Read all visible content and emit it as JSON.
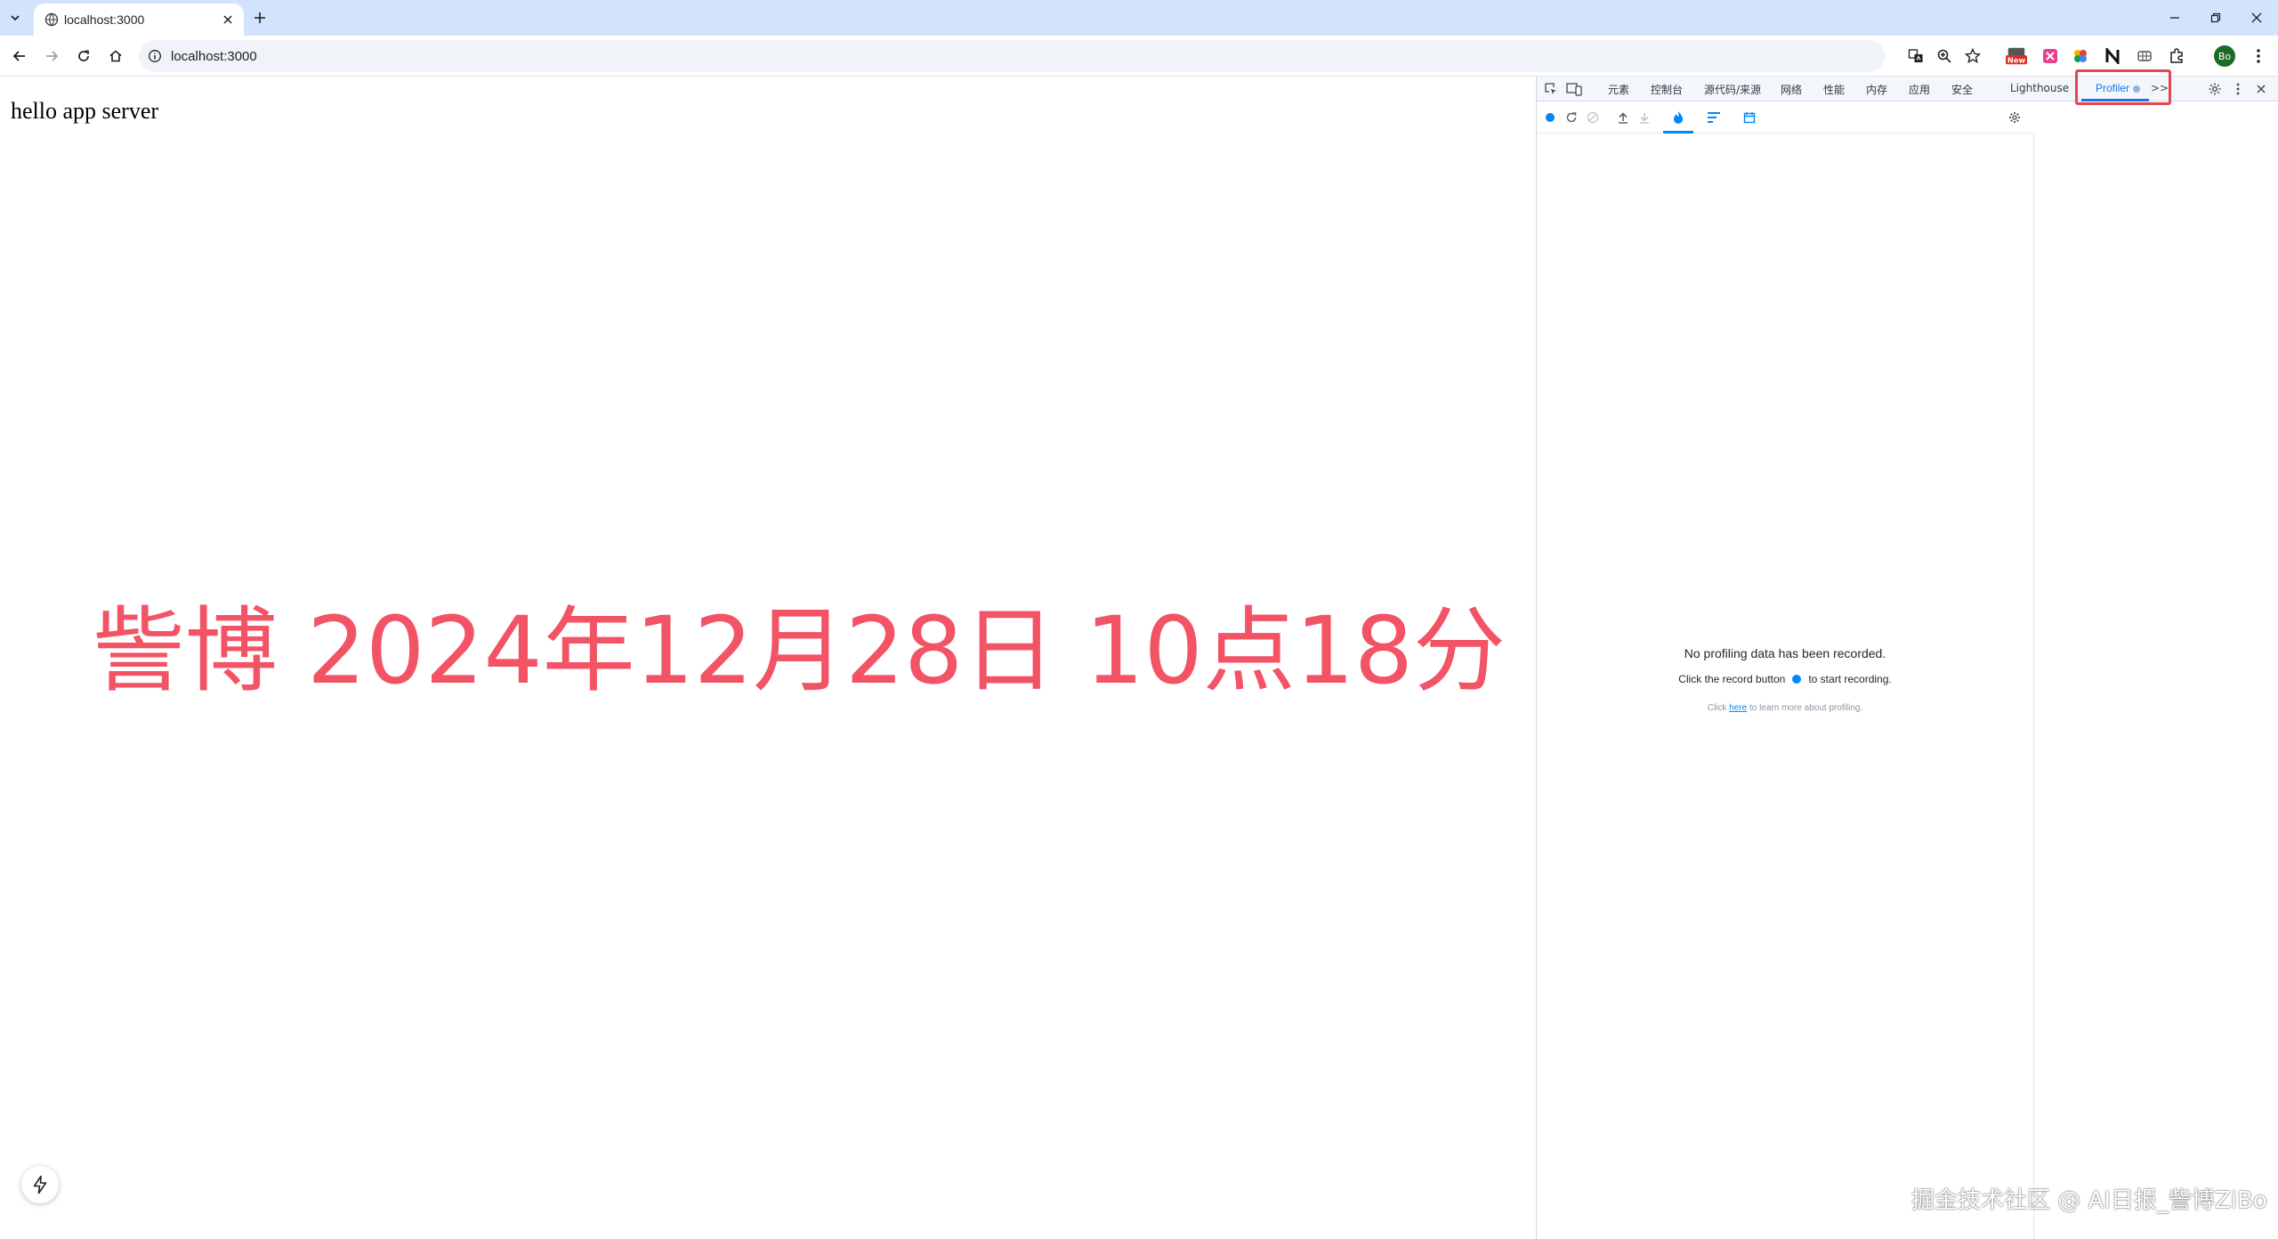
{
  "browser": {
    "tab": {
      "title": "localhost:3000"
    },
    "address": {
      "url": "localhost:3000"
    },
    "profile_initials": "Bo"
  },
  "page": {
    "hello_text": "hello app server",
    "overlay_text": "訾博 2024年12月28日 10点18分"
  },
  "devtools": {
    "tabs": [
      "元素",
      "控制台",
      "源代码/来源",
      "网络",
      "性能",
      "内存",
      "应用",
      "安全",
      "Lighthouse"
    ],
    "active_tab": "Profiler",
    "more_tabs": ">>",
    "empty_state": {
      "title": "No profiling data has been recorded.",
      "hint_before": "Click the record button",
      "hint_after": "to start recording.",
      "learn_prefix": "Click",
      "learn_link": "here",
      "learn_suffix": "to learn more about profiling."
    }
  },
  "watermark": "掘金技术社区 @ AI日报_訾博ZiBo",
  "colors": {
    "tabstrip_bg": "#d3e3fd",
    "overlay_red": "#f25466",
    "devtools_accent": "#1a73e8",
    "react_blue": "#0088fa",
    "highlight_red": "#e4454f"
  }
}
